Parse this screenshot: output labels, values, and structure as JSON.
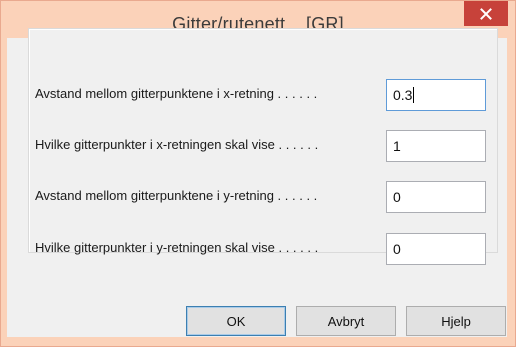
{
  "window": {
    "title": "Gitter/rutenett...  [GR]",
    "close_icon": "close-icon"
  },
  "form": {
    "rows": [
      {
        "label": "Avstand mellom gitterpunktene i x-retning . . . . . .",
        "value": "0.3",
        "focused": true
      },
      {
        "label": "Hvilke gitterpunkter i x-retningen skal vise . . . . . .",
        "value": "1"
      },
      {
        "label": "Avstand mellom gitterpunktene i y-retning . . . . . .",
        "value": "0"
      },
      {
        "label": "Hvilke gitterpunkter i y-retningen skal vise . . . . . .",
        "value": "0"
      }
    ]
  },
  "buttons": {
    "ok": "OK",
    "cancel": "Avbryt",
    "help": "Hjelp"
  },
  "colors": {
    "titlebar": "#fbd2b9",
    "close": "#c7423a",
    "focus_border": "#5f9bd8"
  }
}
